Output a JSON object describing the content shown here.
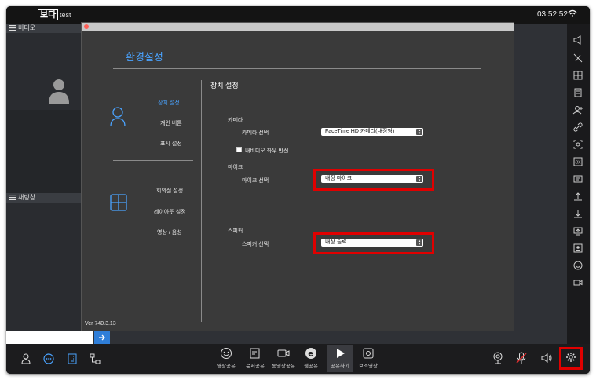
{
  "topbar": {
    "logo": "보다",
    "app_sub": "test",
    "clock": "03:52:52"
  },
  "left_panel": {
    "video_header": "비디오",
    "chat_header": "채팅창",
    "send_icon": "arrow-right-icon"
  },
  "dialog": {
    "title": "환경설정",
    "nav": {
      "device": "장치 설정",
      "personal": "개인 버튼",
      "display": "표시 설정",
      "meeting_room": "회의실 설정",
      "layout": "레이아웃 설정",
      "video_audio": "영상 / 음성"
    },
    "version": "Ver 740.3.13",
    "section_title": "장치 설정",
    "camera": {
      "group": "카메라",
      "label": "카메라 선택",
      "value": "FaceTime HD 카메라(내장형)",
      "mirror": "내비디오 좌우 반전"
    },
    "mic": {
      "group": "마이크",
      "label": "마이크 선택",
      "value": "내장 마이크"
    },
    "speaker": {
      "group": "스피커",
      "label": "스피커 선택",
      "value": "내장 출력"
    }
  },
  "bottom": {
    "share_video": "영상공유",
    "share_doc": "문서공유",
    "share_movie": "동영상공유",
    "share_web": "웹공유",
    "share_play": "공유하기",
    "aux_video": "보조영상"
  },
  "colors": {
    "accent": "#4aa3ff",
    "highlight": "#e00000",
    "send": "#2f7ed8"
  }
}
